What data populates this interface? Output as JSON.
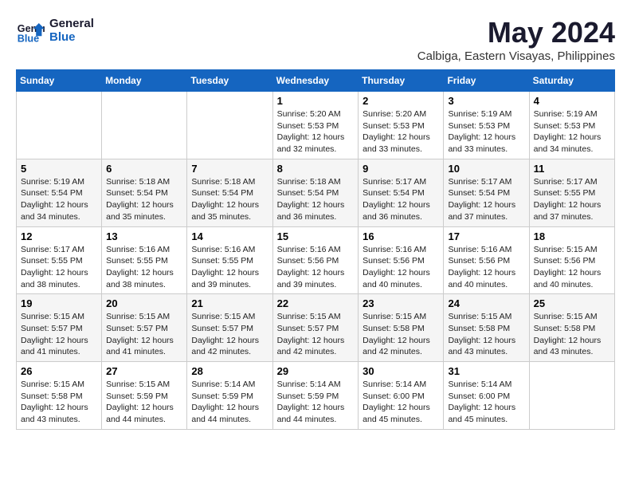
{
  "header": {
    "logo_line1": "General",
    "logo_line2": "Blue",
    "month": "May 2024",
    "location": "Calbiga, Eastern Visayas, Philippines"
  },
  "weekdays": [
    "Sunday",
    "Monday",
    "Tuesday",
    "Wednesday",
    "Thursday",
    "Friday",
    "Saturday"
  ],
  "weeks": [
    [
      {
        "day": "",
        "info": ""
      },
      {
        "day": "",
        "info": ""
      },
      {
        "day": "",
        "info": ""
      },
      {
        "day": "1",
        "info": "Sunrise: 5:20 AM\nSunset: 5:53 PM\nDaylight: 12 hours\nand 32 minutes."
      },
      {
        "day": "2",
        "info": "Sunrise: 5:20 AM\nSunset: 5:53 PM\nDaylight: 12 hours\nand 33 minutes."
      },
      {
        "day": "3",
        "info": "Sunrise: 5:19 AM\nSunset: 5:53 PM\nDaylight: 12 hours\nand 33 minutes."
      },
      {
        "day": "4",
        "info": "Sunrise: 5:19 AM\nSunset: 5:53 PM\nDaylight: 12 hours\nand 34 minutes."
      }
    ],
    [
      {
        "day": "5",
        "info": "Sunrise: 5:19 AM\nSunset: 5:54 PM\nDaylight: 12 hours\nand 34 minutes."
      },
      {
        "day": "6",
        "info": "Sunrise: 5:18 AM\nSunset: 5:54 PM\nDaylight: 12 hours\nand 35 minutes."
      },
      {
        "day": "7",
        "info": "Sunrise: 5:18 AM\nSunset: 5:54 PM\nDaylight: 12 hours\nand 35 minutes."
      },
      {
        "day": "8",
        "info": "Sunrise: 5:18 AM\nSunset: 5:54 PM\nDaylight: 12 hours\nand 36 minutes."
      },
      {
        "day": "9",
        "info": "Sunrise: 5:17 AM\nSunset: 5:54 PM\nDaylight: 12 hours\nand 36 minutes."
      },
      {
        "day": "10",
        "info": "Sunrise: 5:17 AM\nSunset: 5:54 PM\nDaylight: 12 hours\nand 37 minutes."
      },
      {
        "day": "11",
        "info": "Sunrise: 5:17 AM\nSunset: 5:55 PM\nDaylight: 12 hours\nand 37 minutes."
      }
    ],
    [
      {
        "day": "12",
        "info": "Sunrise: 5:17 AM\nSunset: 5:55 PM\nDaylight: 12 hours\nand 38 minutes."
      },
      {
        "day": "13",
        "info": "Sunrise: 5:16 AM\nSunset: 5:55 PM\nDaylight: 12 hours\nand 38 minutes."
      },
      {
        "day": "14",
        "info": "Sunrise: 5:16 AM\nSunset: 5:55 PM\nDaylight: 12 hours\nand 39 minutes."
      },
      {
        "day": "15",
        "info": "Sunrise: 5:16 AM\nSunset: 5:56 PM\nDaylight: 12 hours\nand 39 minutes."
      },
      {
        "day": "16",
        "info": "Sunrise: 5:16 AM\nSunset: 5:56 PM\nDaylight: 12 hours\nand 40 minutes."
      },
      {
        "day": "17",
        "info": "Sunrise: 5:16 AM\nSunset: 5:56 PM\nDaylight: 12 hours\nand 40 minutes."
      },
      {
        "day": "18",
        "info": "Sunrise: 5:15 AM\nSunset: 5:56 PM\nDaylight: 12 hours\nand 40 minutes."
      }
    ],
    [
      {
        "day": "19",
        "info": "Sunrise: 5:15 AM\nSunset: 5:57 PM\nDaylight: 12 hours\nand 41 minutes."
      },
      {
        "day": "20",
        "info": "Sunrise: 5:15 AM\nSunset: 5:57 PM\nDaylight: 12 hours\nand 41 minutes."
      },
      {
        "day": "21",
        "info": "Sunrise: 5:15 AM\nSunset: 5:57 PM\nDaylight: 12 hours\nand 42 minutes."
      },
      {
        "day": "22",
        "info": "Sunrise: 5:15 AM\nSunset: 5:57 PM\nDaylight: 12 hours\nand 42 minutes."
      },
      {
        "day": "23",
        "info": "Sunrise: 5:15 AM\nSunset: 5:58 PM\nDaylight: 12 hours\nand 42 minutes."
      },
      {
        "day": "24",
        "info": "Sunrise: 5:15 AM\nSunset: 5:58 PM\nDaylight: 12 hours\nand 43 minutes."
      },
      {
        "day": "25",
        "info": "Sunrise: 5:15 AM\nSunset: 5:58 PM\nDaylight: 12 hours\nand 43 minutes."
      }
    ],
    [
      {
        "day": "26",
        "info": "Sunrise: 5:15 AM\nSunset: 5:58 PM\nDaylight: 12 hours\nand 43 minutes."
      },
      {
        "day": "27",
        "info": "Sunrise: 5:15 AM\nSunset: 5:59 PM\nDaylight: 12 hours\nand 44 minutes."
      },
      {
        "day": "28",
        "info": "Sunrise: 5:14 AM\nSunset: 5:59 PM\nDaylight: 12 hours\nand 44 minutes."
      },
      {
        "day": "29",
        "info": "Sunrise: 5:14 AM\nSunset: 5:59 PM\nDaylight: 12 hours\nand 44 minutes."
      },
      {
        "day": "30",
        "info": "Sunrise: 5:14 AM\nSunset: 6:00 PM\nDaylight: 12 hours\nand 45 minutes."
      },
      {
        "day": "31",
        "info": "Sunrise: 5:14 AM\nSunset: 6:00 PM\nDaylight: 12 hours\nand 45 minutes."
      },
      {
        "day": "",
        "info": ""
      }
    ]
  ]
}
